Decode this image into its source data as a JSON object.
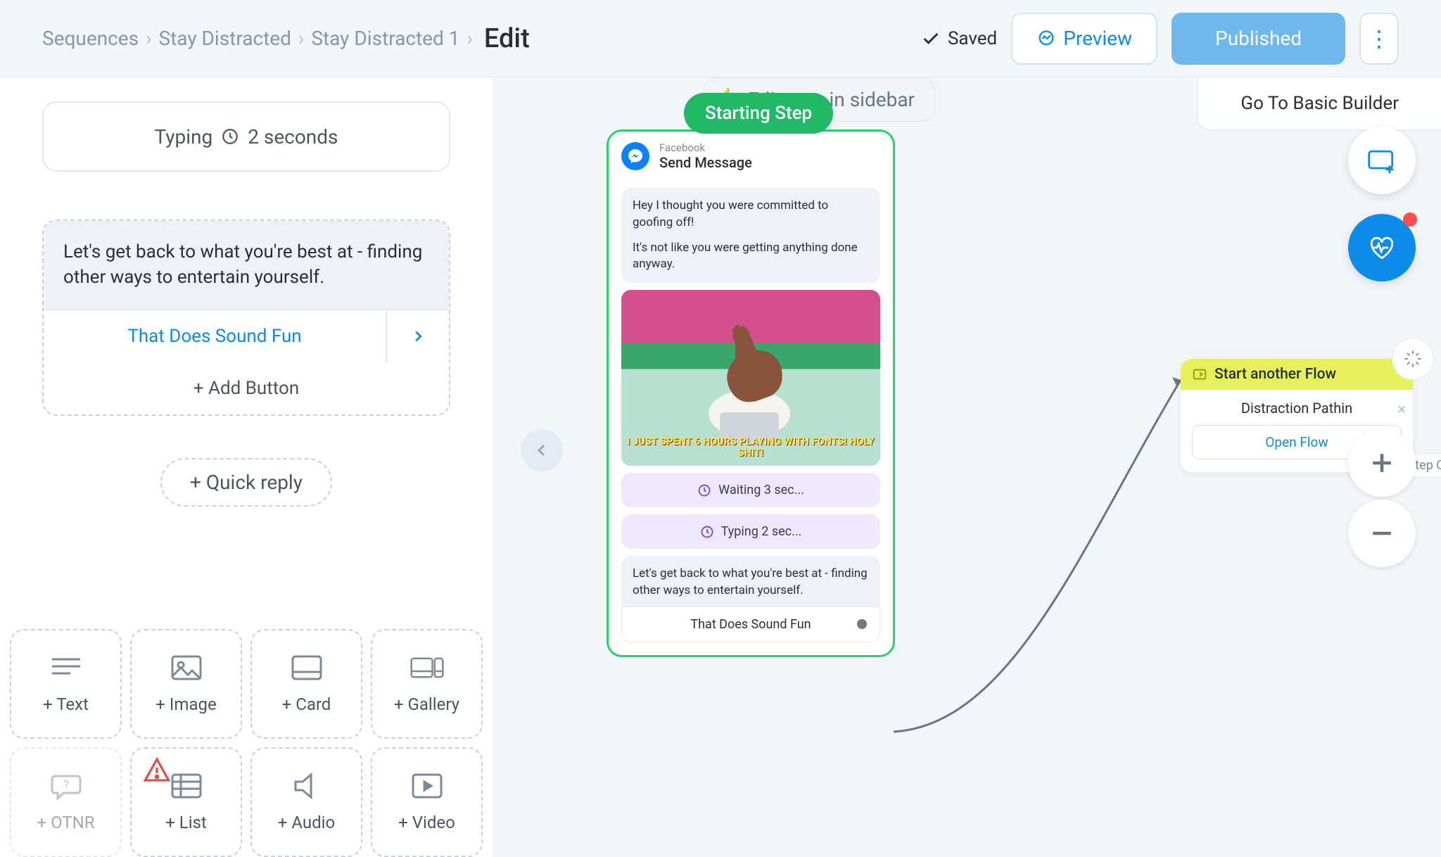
{
  "breadcrumbs": {
    "root": "Sequences",
    "level1": "Stay Distracted",
    "level2": "Stay Distracted 1",
    "current": "Edit"
  },
  "header": {
    "saved": "Saved",
    "preview": "Preview",
    "published": "Published"
  },
  "sidebar": {
    "typing_label": "Typing",
    "typing_duration": "2 seconds",
    "message_text": "Let's get back to what you're best at - finding other ways to entertain yourself.",
    "button_label": "That Does Sound Fun",
    "add_button": "+ Add Button",
    "quick_reply": "+ Quick reply"
  },
  "content_types": {
    "text": "+ Text",
    "image": "+ Image",
    "card": "+ Card",
    "gallery": "+ Gallery",
    "otnr": "+ OTNR",
    "list": "+ List",
    "audio": "+ Audio",
    "video": "+ Video"
  },
  "canvas": {
    "edit_hint": "Edit step in sidebar",
    "starting_badge": "Starting Step",
    "goto_basic": "Go To Basic Builder",
    "node": {
      "platform": "Facebook",
      "title": "Send Message",
      "bubble1": "Hey I thought you were committed to goofing off!",
      "bubble2": "It's not like you were getting anything done anyway.",
      "gif_caption": "I JUST SPENT 6 HOURS PLAYING WITH FONTS! HOLY SHIT!",
      "waiting": "Waiting 3 sec...",
      "typing": "Typing 2 sec...",
      "final_text": "Let's get back to what you're best at - finding other ways to entertain yourself.",
      "final_button": "That Does Sound Fun"
    },
    "flow_card": {
      "header": "Start another Flow",
      "title": "Distraction Pathin",
      "open": "Open Flow",
      "peek": "tep C"
    }
  }
}
